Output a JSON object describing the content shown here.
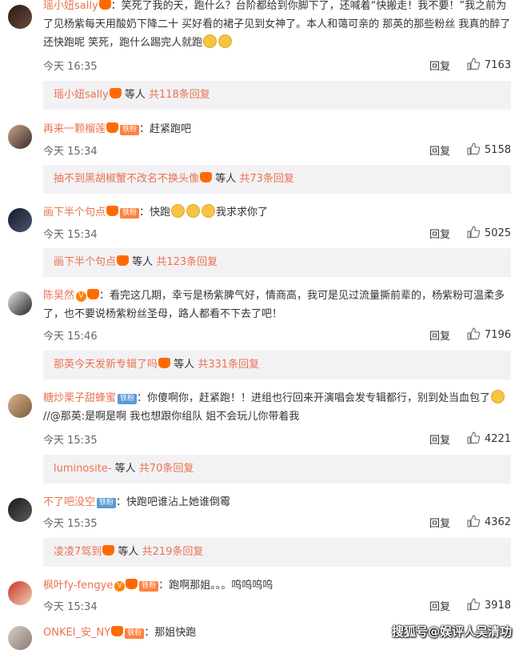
{
  "comments": [
    {
      "user": "瑶小妞sally",
      "text": "：笑死了我的天，跑什么？台阶都给到你脚下了，还喊着“快搬走！我不要！”我之前为了见杨紫每天用酸奶下降二十 买好看的裙子见到女神了。本人和蔼可亲的 那英的那些粉丝 我真的醉了 还快跑呢 笑死，跑什么踢完人就跑",
      "time": "今天 16:35",
      "reply": "回复",
      "likes": "7163",
      "sub": {
        "name": "瑶小妞sally",
        "mid": "等人",
        "count": "共118条回复"
      }
    },
    {
      "user": "再来一颗榴莲",
      "badge": "铁粉",
      "text": "：赶紧跑吧",
      "time": "今天 15:34",
      "reply": "回复",
      "likes": "5158",
      "sub": {
        "name": "抽不到黑胡椒蟹不改名不换头像",
        "mid": "等人",
        "count": "共73条回复"
      }
    },
    {
      "user": "画下半个句点",
      "badge": "铁粉",
      "text": "：快跑",
      "text2": "我求求你了",
      "time": "今天 15:34",
      "reply": "回复",
      "likes": "5025",
      "sub": {
        "name": "画下半个句点",
        "mid": "等人",
        "count": "共123条回复"
      }
    },
    {
      "user": "陈昊然",
      "text": "：看完这几期，幸亏是杨紫脾气好，情商高，我可是见过流量撕前辈的，杨紫粉可温柔多了，也不要说杨紫粉丝圣母，路人都看不下去了吧！",
      "time": "今天 15:46",
      "reply": "回复",
      "likes": "7196",
      "sub": {
        "name": "那英今天发新专辑了吗",
        "mid": "等人",
        "count": "共331条回复"
      }
    },
    {
      "user": "糖炒栗子甜蜂蜜",
      "badge": "铁粉",
      "text": "：你傻啊你，赶紧跑！！进组也行回来开演唱会发专辑都行，别到处当血包了",
      "text2": "//@那英:是啊是啊 我也想跟你组队 姐不会玩儿你带着我",
      "time": "今天 15:35",
      "reply": "回复",
      "likes": "4221",
      "sub": {
        "name": "luminosite-",
        "mid": "等人",
        "count": "共70条回复"
      }
    },
    {
      "user": "不了吧没空",
      "badge": "铁粉",
      "text": "：快跑吧谁沾上她谁倒霉",
      "time": "今天 15:35",
      "reply": "回复",
      "likes": "4362",
      "sub": {
        "name": "凌凌7驾到",
        "mid": "等人",
        "count": "共219条回复"
      }
    },
    {
      "user": "枫叶fy-fengye",
      "badge": "铁粉",
      "text": "：跑啊那姐。。。呜呜呜呜",
      "time": "今天 15:34",
      "reply": "回复",
      "likes": "3918"
    },
    {
      "user": "ONKEI_安_NY",
      "badge": "铁粉",
      "text": "：那姐快跑"
    }
  ],
  "watermark": "搜狐号@娱评人吴清功",
  "colors": {
    "username": "#eb7350",
    "subbox_bg": "#f2f2f5"
  }
}
